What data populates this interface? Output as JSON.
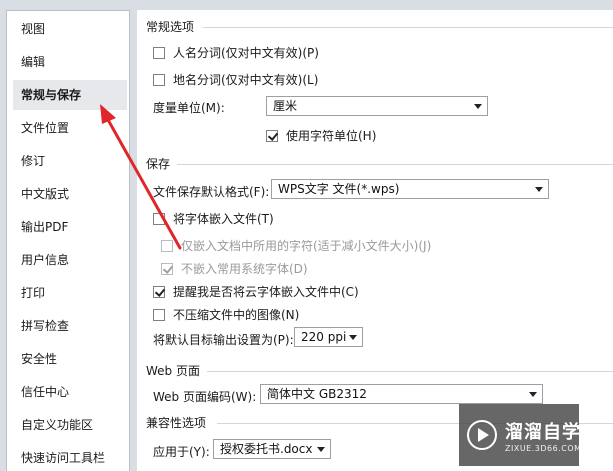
{
  "sidebar": {
    "items": [
      {
        "label": "视图"
      },
      {
        "label": "编辑"
      },
      {
        "label": "常规与保存",
        "selected": true
      },
      {
        "label": "文件位置"
      },
      {
        "label": "修订"
      },
      {
        "label": "中文版式"
      },
      {
        "label": "输出PDF"
      },
      {
        "label": "用户信息"
      },
      {
        "label": "打印"
      },
      {
        "label": "拼写检查"
      },
      {
        "label": "安全性"
      },
      {
        "label": "信任中心"
      },
      {
        "label": "自定义功能区"
      },
      {
        "label": "快速访问工具栏"
      }
    ]
  },
  "general": {
    "title": "常规选项",
    "name_seg": {
      "label": "人名分词(仅对中文有效)(P)",
      "checked": false
    },
    "place_seg": {
      "label": "地名分词(仅对中文有效)(L)",
      "checked": false
    },
    "unit_label": "度量单位(M):",
    "unit_value": "厘米",
    "char_unit": {
      "label": "使用字符单位(H)",
      "checked": true
    }
  },
  "save": {
    "title": "保存",
    "format_label": "文件保存默认格式(F):",
    "format_value": "WPS文字 文件(*.wps)",
    "embed_fonts": {
      "label": "将字体嵌入文件(T)",
      "checked": false
    },
    "embed_used_only": {
      "label": "仅嵌入文档中所用的字符(适于减小文件大小)(J)",
      "checked": false
    },
    "no_common_fonts": {
      "label": "不嵌入常用系统字体(D)",
      "checked": true
    },
    "remind_cloud_fonts": {
      "label": "提醒我是否将云字体嵌入文件中(C)",
      "checked": true
    },
    "no_compress_images": {
      "label": "不压缩文件中的图像(N)",
      "checked": false
    },
    "output_label": "将默认目标输出设置为(P):",
    "output_value": "220 ppi"
  },
  "web": {
    "title": "Web 页面",
    "encoding_label": "Web 页面编码(W):",
    "encoding_value": "简体中文 GB2312"
  },
  "compat": {
    "title": "兼容性选项",
    "apply_label": "应用于(Y):",
    "apply_value": "授权委托书.docx"
  },
  "watermark": {
    "text": "溜溜自学",
    "sub": "ZIXUE.3D66.COM"
  },
  "colors": {
    "annotation_arrow": "#e0262b",
    "selected_bg": "#e6e8ec"
  }
}
